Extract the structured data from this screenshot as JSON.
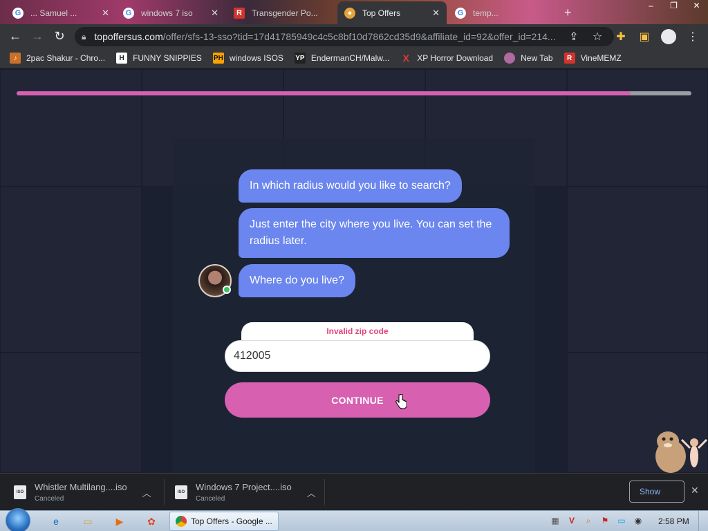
{
  "browser": {
    "tabs": [
      {
        "title": "... Samuel ...",
        "favicon": "google-icon",
        "active": false
      },
      {
        "title": "windows 7 iso",
        "favicon": "google-icon",
        "active": false
      },
      {
        "title": "Transgender Po...",
        "favicon": "redtube-icon",
        "active": false
      },
      {
        "title": "Top Offers",
        "favicon": "topoffers-icon",
        "active": true
      },
      {
        "title": "temp...",
        "favicon": "google-icon",
        "active": false
      }
    ],
    "address": {
      "host": "topoffersus.com",
      "path": "/offer/sfs-13-sso?tid=17d41785949c4c5c8bf10d7862cd35d9&affiliate_id=92&offer_id=214..."
    },
    "bookmarks": [
      {
        "label": "2pac Shakur - Chro...",
        "icon": "bookmark-2pac-icon",
        "color": "#c9702a"
      },
      {
        "label": "FUNNY SNIPPIES",
        "icon": "H",
        "color": "#ffffff"
      },
      {
        "label": "windows ISOS",
        "icon": "PH",
        "color": "#f7a300"
      },
      {
        "label": "EndermanCH/Malw...",
        "icon": "YP",
        "color": "#222222"
      },
      {
        "label": "XP Horror Download",
        "icon": "X",
        "color": "#d8312c"
      },
      {
        "label": "New Tab",
        "icon": "newtab-icon",
        "color": "#b06aa0"
      },
      {
        "label": "VineMEMZ",
        "icon": "R",
        "color": "#d0342c"
      }
    ]
  },
  "page": {
    "progress_fraction": 0.91,
    "colors": {
      "accent": "#d760b1",
      "bubble": "#6b86ee",
      "error": "#e0447a"
    },
    "chat": [
      "In which radius would you like to search?",
      "Just enter the city where you live. You can set the radius later.",
      "Where do you live?"
    ],
    "form": {
      "error": "Invalid zip code",
      "zip_value": "412005",
      "continue_label": "CONTINUE"
    }
  },
  "downloads": {
    "items": [
      {
        "name": "Whistler Multilang....iso",
        "status": "Canceled"
      },
      {
        "name": "Windows 7 Project....iso",
        "status": "Canceled"
      }
    ],
    "show_all_label": "Show"
  },
  "taskbar": {
    "active_window": "Top Offers - Google ...",
    "clock": "2:58 PM"
  }
}
